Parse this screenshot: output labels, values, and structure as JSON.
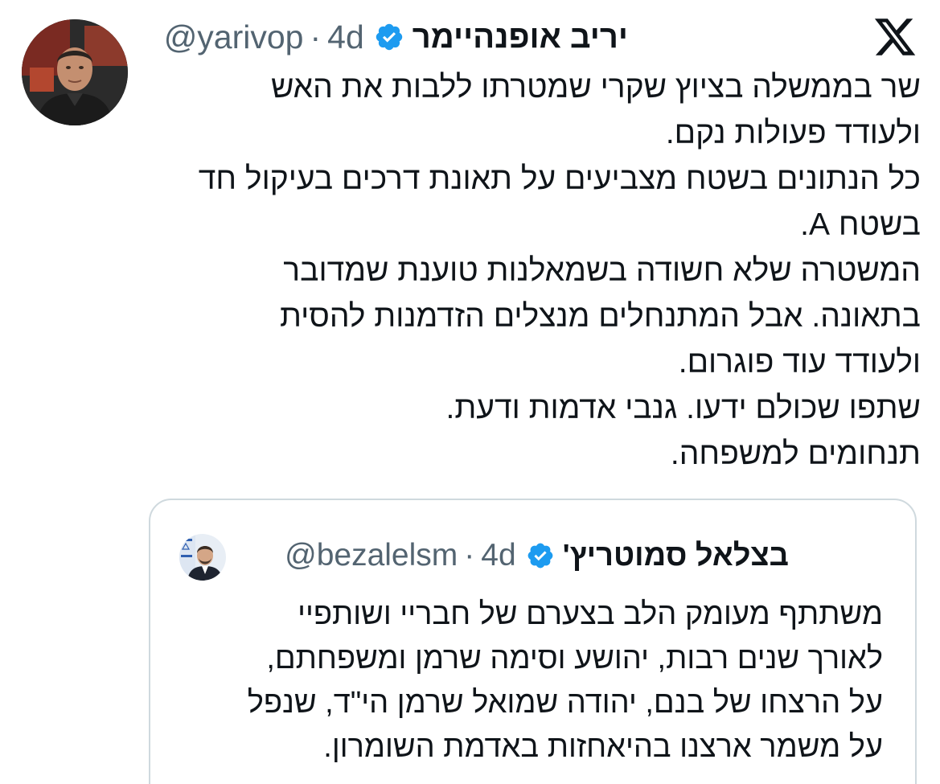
{
  "platform": {
    "logo_icon": "x-logo-icon"
  },
  "tweet": {
    "author": {
      "display_name": "יריב אופנהיימר",
      "handle": "@yarivop",
      "separator": "·",
      "time": "4d",
      "verified_icon": "verified-badge-icon"
    },
    "text": "שר בממשלה בציוץ שקרי שמטרתו ללבות את האש\nולעודד פעולות נקם.\nכל הנתונים בשטח מצביעים על תאונת דרכים בעיקול חד\nבשטח A.\nהמשטרה שלא חשודה בשמאלנות טוענת שמדובר\nבתאונה. אבל המתנחלים מנצלים הזדמנות להסית\nולעודד עוד פוגרום.\nשתפו שכולם ידעו. גנבי אדמות ודעת.\nתנחומים למשפחה."
  },
  "quoted_tweet": {
    "author": {
      "display_name": "בצלאל סמוטריץ'",
      "handle": "@bezalelsm",
      "separator": "·",
      "time": "4d",
      "verified_icon": "verified-badge-icon"
    },
    "text": "משתתף מעומק הלב בצערם של חבריי ושותפיי\nלאורך שנים רבות, יהושע וסימה שרמן ומשפחתם,\nעל הרצחו של בנם, יהודה שמואל שרמן הי\"ד, שנפל\nעל משמר ארצנו בהיאחזות באדמת השומרון."
  },
  "colors": {
    "text": "#0f1419",
    "secondary_text": "#536471",
    "verified_blue": "#1d9bf0",
    "border": "#cfd9de"
  }
}
